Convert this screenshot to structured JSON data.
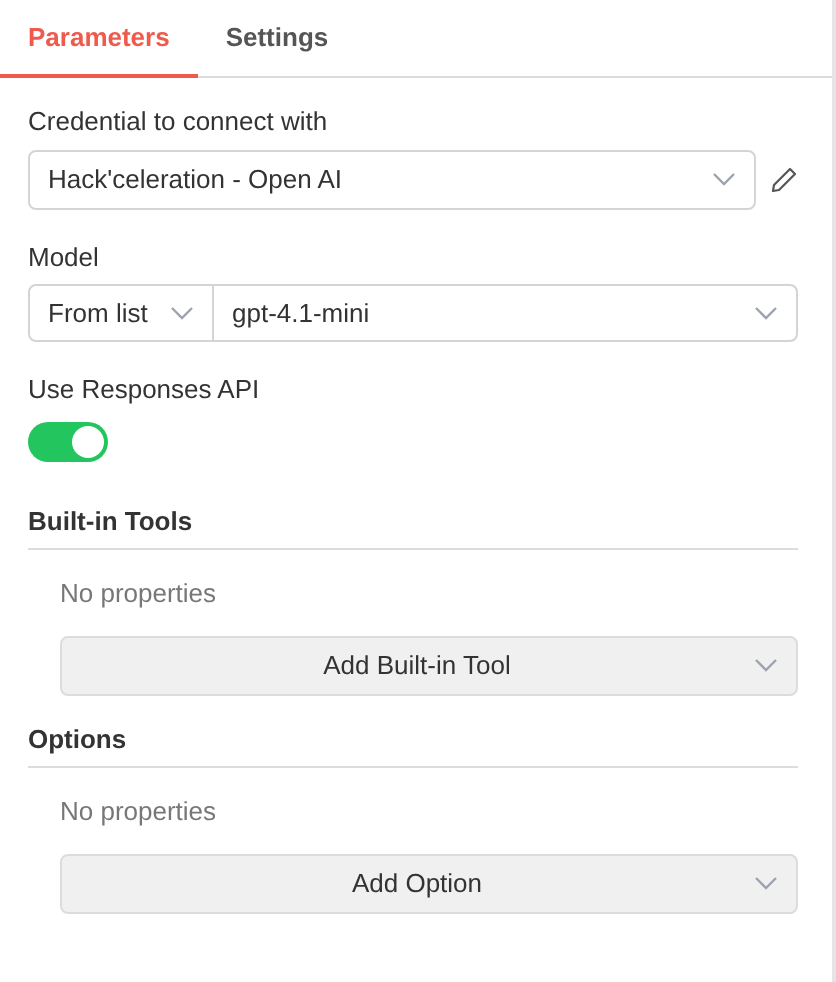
{
  "tabs": [
    {
      "label": "Parameters",
      "selected": true
    },
    {
      "label": "Settings",
      "selected": false
    }
  ],
  "credential": {
    "label": "Credential to connect with",
    "value": "Hack'celeration - Open AI"
  },
  "model": {
    "label": "Model",
    "mode": "From list",
    "value": "gpt-4.1-mini"
  },
  "use_responses_api": {
    "label": "Use Responses API",
    "on": true
  },
  "sections": [
    {
      "title": "Built-in Tools",
      "empty_text": "No properties",
      "button": "Add Built-in Tool"
    },
    {
      "title": "Options",
      "empty_text": "No properties",
      "button": "Add Option"
    }
  ]
}
